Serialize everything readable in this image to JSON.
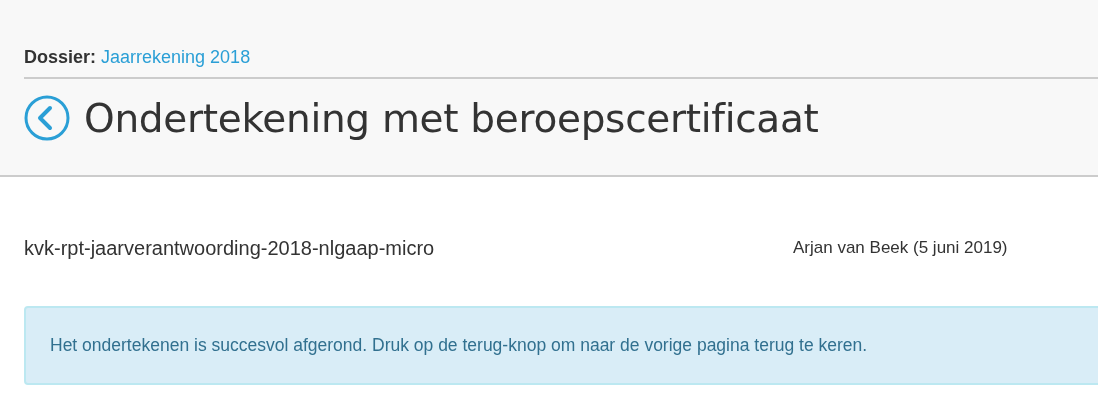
{
  "breadcrumb": {
    "label": "Dossier:",
    "link": "Jaarrekening 2018"
  },
  "page_title": "Ondertekening met beroepscertificaat",
  "document": {
    "name": "kvk-rpt-jaarverantwoording-2018-nlgaap-micro",
    "signed_by": "Arjan van Beek (5 juni 2019)"
  },
  "alert": {
    "kind": "info",
    "message": "Het ondertekenen is succesvol afgerond. Druk op de terug-knop om naar de vorige pagina terug te keren."
  }
}
